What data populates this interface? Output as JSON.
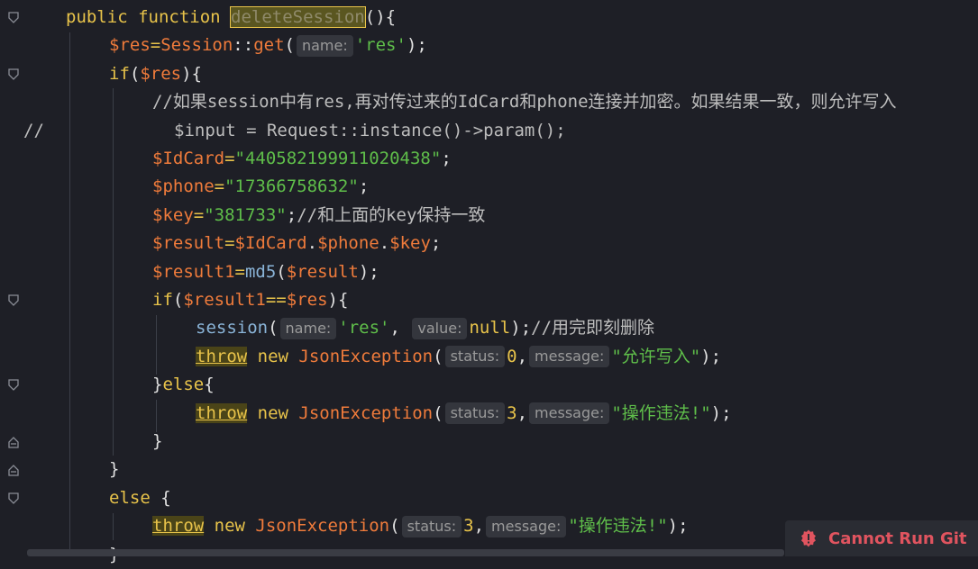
{
  "editor": {
    "lines": [
      {
        "indent": 73,
        "tokens": [
          [
            "kw",
            "public function "
          ],
          [
            "hl",
            "deleteSession"
          ],
          [
            "plain",
            "(){"
          ]
        ]
      },
      {
        "indent": 121,
        "tokens": [
          [
            "var",
            "$res"
          ],
          [
            "op",
            "="
          ],
          [
            "cls",
            "Session"
          ],
          [
            "plain",
            "::"
          ],
          [
            "var",
            "get"
          ],
          [
            "plain",
            "("
          ],
          [
            "hint",
            "name:"
          ],
          [
            "str",
            "'res'"
          ],
          [
            "plain",
            ");"
          ]
        ]
      },
      {
        "indent": 121,
        "tokens": [
          [
            "kw",
            "if"
          ],
          [
            "plain",
            "("
          ],
          [
            "var",
            "$res"
          ],
          [
            "plain",
            "){"
          ]
        ]
      },
      {
        "indent": 169,
        "tokens": [
          [
            "cmt",
            "//如果session中有res,再对传过来的IdCard和phone连接并加密。如果结果一致，则允许写入"
          ]
        ]
      },
      {
        "indent": 193,
        "tokens": [
          [
            "cmt",
            "$input = Request::instance()->param();"
          ]
        ]
      },
      {
        "indent": 169,
        "tokens": [
          [
            "var",
            "$IdCard"
          ],
          [
            "op",
            "="
          ],
          [
            "str",
            "\"440582199911020438\""
          ],
          [
            "plain",
            ";"
          ]
        ]
      },
      {
        "indent": 169,
        "tokens": [
          [
            "var",
            "$phone"
          ],
          [
            "op",
            "="
          ],
          [
            "str",
            "\"17366758632\""
          ],
          [
            "plain",
            ";"
          ]
        ]
      },
      {
        "indent": 169,
        "tokens": [
          [
            "var",
            "$key"
          ],
          [
            "op",
            "="
          ],
          [
            "str",
            "\"381733\""
          ],
          [
            "plain",
            ";"
          ],
          [
            "cmt",
            "//和上面的key保持一致"
          ]
        ]
      },
      {
        "indent": 169,
        "tokens": [
          [
            "var",
            "$result"
          ],
          [
            "op",
            "="
          ],
          [
            "var",
            "$IdCard"
          ],
          [
            "plain",
            "."
          ],
          [
            "var",
            "$phone"
          ],
          [
            "plain",
            "."
          ],
          [
            "var",
            "$key"
          ],
          [
            "plain",
            ";"
          ]
        ]
      },
      {
        "indent": 169,
        "tokens": [
          [
            "var",
            "$result1"
          ],
          [
            "op",
            "="
          ],
          [
            "fn",
            "md5"
          ],
          [
            "plain",
            "("
          ],
          [
            "var",
            "$result"
          ],
          [
            "plain",
            ");"
          ]
        ]
      },
      {
        "indent": 169,
        "tokens": [
          [
            "kw",
            "if"
          ],
          [
            "plain",
            "("
          ],
          [
            "var",
            "$result1"
          ],
          [
            "op",
            "=="
          ],
          [
            "var",
            "$res"
          ],
          [
            "plain",
            "){"
          ]
        ]
      },
      {
        "indent": 217,
        "tokens": [
          [
            "fn",
            "session"
          ],
          [
            "plain",
            "("
          ],
          [
            "hint",
            "name:"
          ],
          [
            "str",
            "'res'"
          ],
          [
            "plain",
            ", "
          ],
          [
            "hint",
            "value:"
          ],
          [
            "kw",
            "null"
          ],
          [
            "plain",
            ");"
          ],
          [
            "cmt",
            "//用完即刻删除"
          ]
        ]
      },
      {
        "indent": 217,
        "tokens": [
          [
            "throw",
            "throw"
          ],
          [
            "kw",
            " new "
          ],
          [
            "cls",
            "JsonException"
          ],
          [
            "plain",
            "("
          ],
          [
            "hint",
            "status:"
          ],
          [
            "kw",
            "0"
          ],
          [
            "plain",
            ","
          ],
          [
            "hint",
            "message:"
          ],
          [
            "str",
            "\"允许写入\""
          ],
          [
            "plain",
            ");"
          ]
        ]
      },
      {
        "indent": 169,
        "tokens": [
          [
            "plain",
            "}"
          ],
          [
            "kw",
            "else"
          ],
          [
            "plain",
            "{"
          ]
        ]
      },
      {
        "indent": 217,
        "tokens": [
          [
            "throw",
            "throw"
          ],
          [
            "kw",
            " new "
          ],
          [
            "cls",
            "JsonException"
          ],
          [
            "plain",
            "("
          ],
          [
            "hint",
            "status:"
          ],
          [
            "kw",
            "3"
          ],
          [
            "plain",
            ","
          ],
          [
            "hint",
            "message:"
          ],
          [
            "str",
            "\"操作违法!\""
          ],
          [
            "plain",
            ");"
          ]
        ]
      },
      {
        "indent": 169,
        "tokens": [
          [
            "plain",
            "}"
          ]
        ]
      },
      {
        "indent": 121,
        "tokens": [
          [
            "plain",
            "}"
          ]
        ]
      },
      {
        "indent": 121,
        "tokens": [
          [
            "kw",
            "else "
          ],
          [
            "plain",
            "{"
          ]
        ]
      },
      {
        "indent": 169,
        "tokens": [
          [
            "throw",
            "throw"
          ],
          [
            "kw",
            " new "
          ],
          [
            "cls",
            "JsonException"
          ],
          [
            "plain",
            "("
          ],
          [
            "hint",
            "status:"
          ],
          [
            "kw",
            "3"
          ],
          [
            "plain",
            ","
          ],
          [
            "hint",
            "message:"
          ],
          [
            "str",
            "\"操作违法!\""
          ],
          [
            "plain",
            ");"
          ]
        ]
      },
      {
        "indent": 121,
        "tokens": [
          [
            "plain",
            "}"
          ]
        ]
      }
    ],
    "comment_marker": "//"
  },
  "toast": {
    "message": "Cannot Run Git",
    "icon": "error-icon"
  }
}
